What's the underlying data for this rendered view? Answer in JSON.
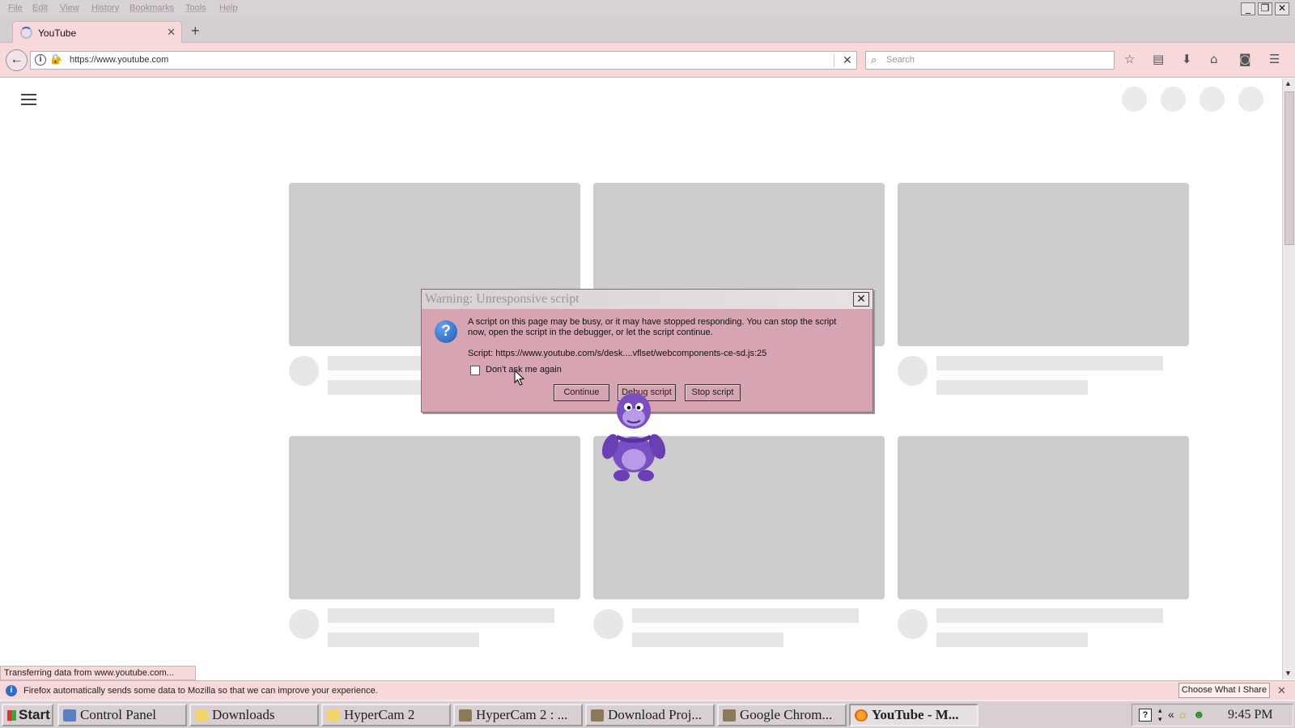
{
  "menubar": {
    "items": [
      "File",
      "Edit",
      "View",
      "History",
      "Bookmarks",
      "Tools",
      "Help"
    ],
    "window_controls": [
      "minimize",
      "restore",
      "close"
    ]
  },
  "tabs": [
    {
      "title": "YouTube",
      "active": true,
      "icon": "loading-spinner-icon"
    }
  ],
  "navbar": {
    "url": "https://www.youtube.com",
    "search_placeholder": "Search",
    "tools": [
      "star-icon",
      "reading-list-icon",
      "download-icon",
      "home-icon",
      "pocket-icon",
      "menu-icon"
    ]
  },
  "status_tooltip": "Transferring data from www.youtube.com...",
  "notification": {
    "text": "Firefox automatically sends some data to Mozilla so that we can improve your experience.",
    "button": "Choose What I Share"
  },
  "dialog": {
    "title": "Warning: Unresponsive script",
    "message": "A script on this page may be busy, or it may have stopped responding. You can stop the script now, open the script in the debugger, or let the script continue.",
    "script": "Script: https://www.youtube.com/s/desk....vflset/webcomponents-ce-sd.js:25",
    "checkbox_label": "Don't ask me again",
    "checkbox_checked": false,
    "buttons": {
      "continue": "Continue",
      "debug": "Debug script",
      "stop": "Stop script"
    }
  },
  "taskbar": {
    "start": "Start",
    "items": [
      {
        "label": "Control Panel",
        "icon": "control-panel-icon",
        "active": false
      },
      {
        "label": "Downloads",
        "icon": "folder-icon",
        "active": false
      },
      {
        "label": "HyperCam 2",
        "icon": "folder-icon",
        "active": false
      },
      {
        "label": "HyperCam 2 : ...",
        "icon": "hypercam-icon",
        "active": false
      },
      {
        "label": "Download Proj...",
        "icon": "hypercam-icon",
        "active": false
      },
      {
        "label": "Google Chrom...",
        "icon": "hypercam-icon",
        "active": false
      },
      {
        "label": "YouTube - M...",
        "icon": "firefox-icon",
        "active": true
      }
    ],
    "clock": "9:45 PM"
  },
  "colors": {
    "chrome_pink": "#f7d9dc",
    "dialog_bg": "#d7a5b2",
    "skeleton": "#cdcdcd",
    "mascot_purple": "#7a4fc4"
  }
}
